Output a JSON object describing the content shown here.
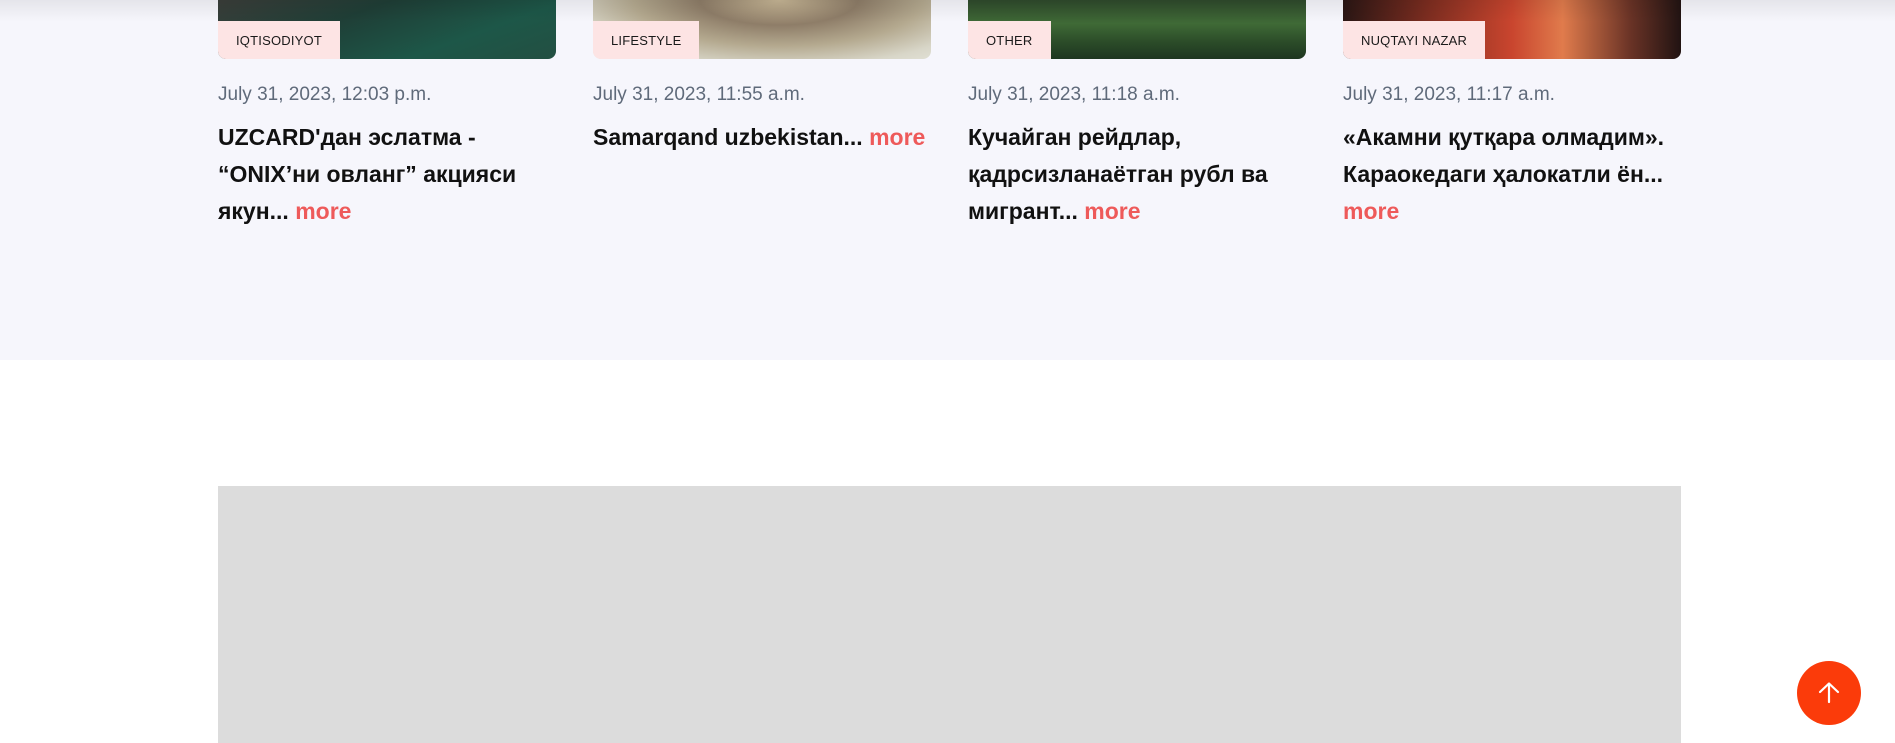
{
  "news": {
    "cards": [
      {
        "category": "IQTISODIYOT",
        "date": "July 31, 2023, 12:03 p.m.",
        "title": "UZCARD'дан эслатма - “ONIX’ни овланг” акцияси якун...",
        "more": "more"
      },
      {
        "category": "LIFESTYLE",
        "date": "July 31, 2023, 11:55 a.m.",
        "title": "Samarqand uzbekistan...",
        "more": "more"
      },
      {
        "category": "OTHER",
        "date": "July 31, 2023, 11:18 a.m.",
        "title": "Кучайган рейдлар, қадрсизланаётган рубл ва мигрант...",
        "more": "more"
      },
      {
        "category": "NUQTAYI NAZAR",
        "date": "July 31, 2023, 11:17 a.m.",
        "title": "«Акамни қутқара олмадим». Караокедаги ҳалокатли ён...",
        "more": "more"
      }
    ]
  },
  "colors": {
    "accent": "#ee5a5a",
    "tag_bg": "#fde4e4",
    "scroll_button": "#fb3b0a",
    "section_bg": "#f6f6fc",
    "ad_placeholder": "#dcdcdc"
  },
  "icons": {
    "scroll_top": "arrow-up-icon"
  }
}
